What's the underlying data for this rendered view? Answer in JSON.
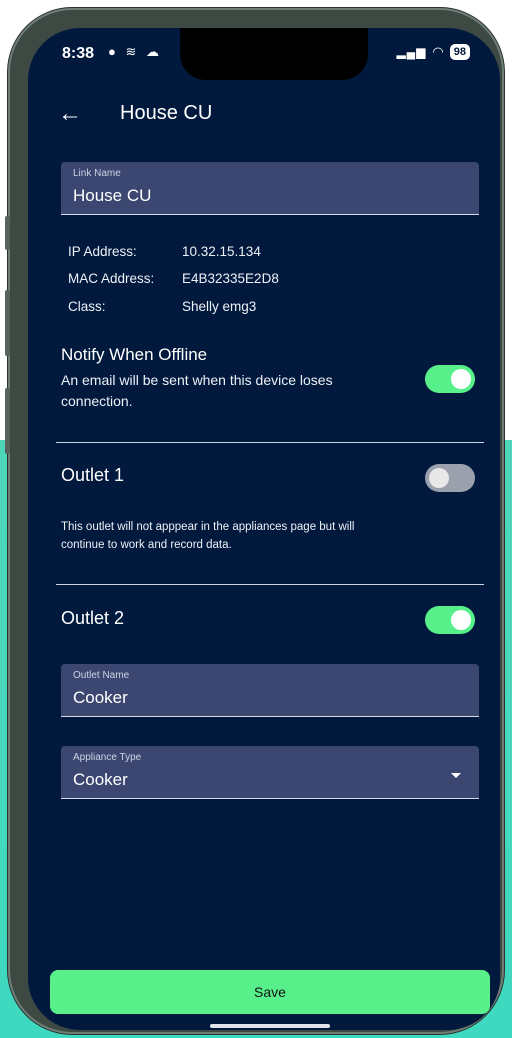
{
  "status_bar": {
    "time": "8:38",
    "icons_left": "● ≋ ☁",
    "signal": "▂▄▆",
    "wifi": "◠",
    "battery": "98"
  },
  "header": {
    "back_icon": "arrow-left-icon",
    "title": "House CU"
  },
  "link_name": {
    "label": "Link Name",
    "value": "House CU"
  },
  "device_info": [
    {
      "key": "IP Address:",
      "value": "10.32.15.134"
    },
    {
      "key": "MAC Address:",
      "value": "E4B32335E2D8"
    },
    {
      "key": "Class:",
      "value": "Shelly emg3"
    }
  ],
  "notify": {
    "title": "Notify When Offline",
    "description_line1": "An email will be sent when this device loses",
    "description_line2": "connection.",
    "enabled": true
  },
  "outlet1": {
    "title": "Outlet 1",
    "enabled": false,
    "description_line1": "This outlet will not apppear in the appliances page but will",
    "description_line2": "continue to work and record data."
  },
  "outlet2": {
    "title": "Outlet 2",
    "enabled": true,
    "name_label": "Outlet Name",
    "name_value": "Cooker",
    "type_label": "Appliance Type",
    "type_value": "Cooker"
  },
  "save_label": "Save",
  "colors": {
    "background": "#00193d",
    "field": "#3b4770",
    "accent_green": "#58f08b",
    "toggle_off": "#9aa0ac"
  }
}
